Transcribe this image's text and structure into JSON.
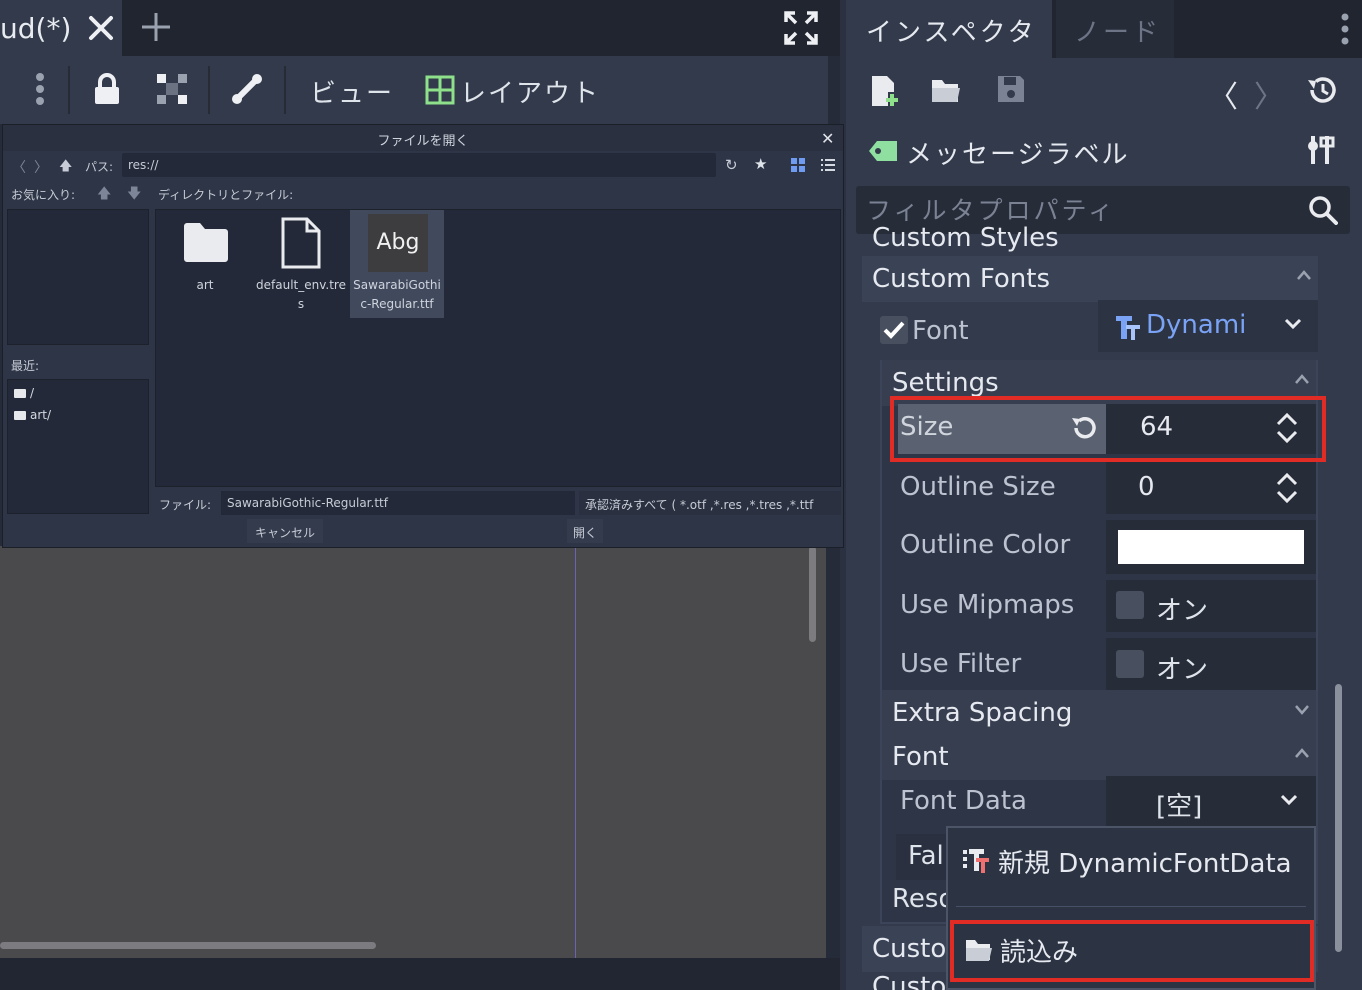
{
  "editor": {
    "scene_tab_label": "ud(*)",
    "toolbar": {
      "view_label": "ビュー",
      "layout_label": "レイアウト"
    }
  },
  "file_dialog": {
    "title": "ファイルを開く",
    "path_label": "パス:",
    "path_value": "res://",
    "favorites_label": "お気に入り:",
    "dir_files_label": "ディレクトリとファイル:",
    "recent_label": "最近:",
    "recent_items": [
      "/",
      "art/"
    ],
    "files": [
      {
        "name": "art",
        "icon": "folder-icon"
      },
      {
        "name": "default_env.tres",
        "icon": "file-icon"
      },
      {
        "name": "SawarabiGothic-Regular.ttf",
        "icon": "font-preview",
        "preview": "Abg",
        "selected": true
      }
    ],
    "file_label": "ファイル:",
    "file_value": "SawarabiGothic-Regular.ttf",
    "filter_value": "承認済みすべて ( *.otf ,*.res ,*.tres ,*.ttf",
    "cancel_label": "キャンセル",
    "open_label": "開く"
  },
  "inspector": {
    "tab_inspector": "インスペクタ",
    "tab_node": "ノード",
    "node_name": "メッセージラベル",
    "filter_placeholder": "フィルタプロパティ",
    "sections": {
      "custom_styles": "Custom Styles",
      "custom_fonts": "Custom Fonts",
      "settings": "Settings",
      "extra_spacing": "Extra Spacing",
      "font": "Font",
      "custom_colors": "Custo",
      "custom_constants": "Custom Constants"
    },
    "font_prop": {
      "label": "Font",
      "checked": true,
      "value": "Dynami"
    },
    "settings": {
      "size_label": "Size",
      "size_value": "64",
      "outline_size_label": "Outline Size",
      "outline_size_value": "0",
      "outline_color_label": "Outline Color",
      "outline_color_value": "#ffffff",
      "use_mipmaps_label": "Use Mipmaps",
      "use_mipmaps_text": "オン",
      "use_filter_label": "Use Filter",
      "use_filter_text": "オン"
    },
    "font_data_label": "Font Data",
    "font_data_value": "[空]",
    "fallback_label": "Fal",
    "resource_label": "Reso",
    "popup_menu": {
      "new_item": "新規 DynamicFontData",
      "load_item": "読込み"
    }
  },
  "colors": {
    "accent_blue": "#7aa2f5",
    "highlight_red": "#e12c26",
    "panel_bg": "#323a4b"
  }
}
